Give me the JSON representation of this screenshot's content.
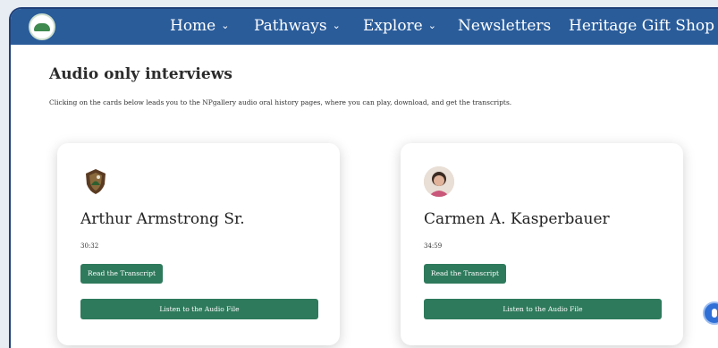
{
  "nav": {
    "items": [
      {
        "label": "Home",
        "has_dropdown": true
      },
      {
        "label": "Pathways",
        "has_dropdown": true
      },
      {
        "label": "Explore",
        "has_dropdown": true
      },
      {
        "label": "Newsletters",
        "has_dropdown": false
      },
      {
        "label": "Heritage Gift Shop",
        "has_dropdown": false
      }
    ],
    "chevron": "⌄",
    "logo_icon": "leaf-logo-icon"
  },
  "section": {
    "title": "Audio only interviews",
    "intro": "Clicking on the cards below leads you to the NPgallery audio oral history pages, where you can play, download, and get the transcripts."
  },
  "cards": [
    {
      "icon": "nps-arrowhead-icon",
      "name": "Arthur Armstrong Sr.",
      "duration": "30:32",
      "transcript_label": "Read the Transcript",
      "audio_label": "Listen to the Audio File"
    },
    {
      "icon": "portrait-photo",
      "name": "Carmen A. Kasperbauer",
      "duration": "34:59",
      "transcript_label": "Read the Transcript",
      "audio_label": "Listen to the Audio File"
    }
  ],
  "accessibility_button_icon": "accessibility-icon",
  "colors": {
    "nav_bg": "#2a5c9a",
    "button_green": "#2e7a5c",
    "accent_blue": "#2f6fd6"
  }
}
